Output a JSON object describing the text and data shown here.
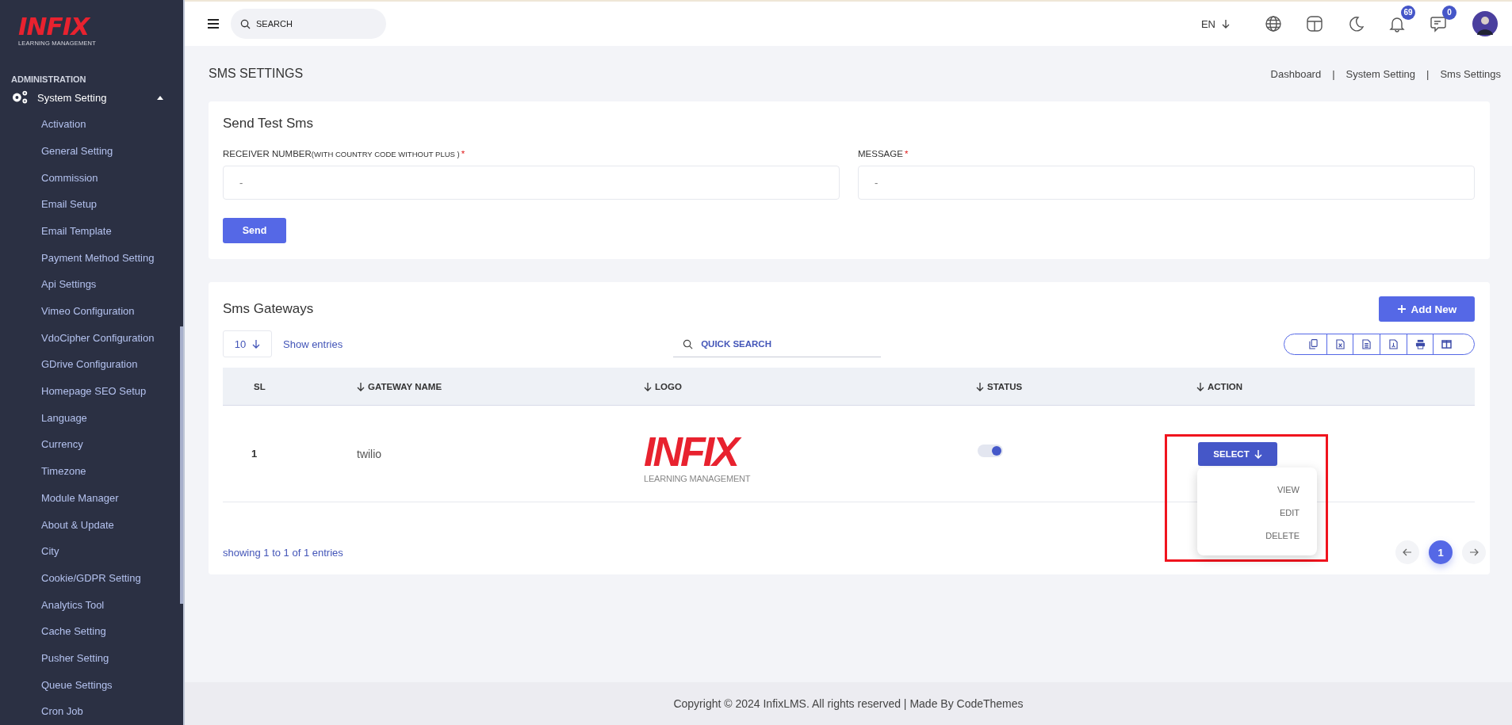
{
  "sidebar": {
    "logo": {
      "wordmark": "INFIX",
      "tagline": "LEARNING MANAGEMENT"
    },
    "section": "ADMINISTRATION",
    "group": {
      "label": "System Setting",
      "expanded": true,
      "items": [
        {
          "label": "Activation"
        },
        {
          "label": "General Setting"
        },
        {
          "label": "Commission"
        },
        {
          "label": "Email Setup"
        },
        {
          "label": "Email Template"
        },
        {
          "label": "Payment Method Setting"
        },
        {
          "label": "Api Settings"
        },
        {
          "label": "Vimeo Configuration"
        },
        {
          "label": "VdoCipher Configuration"
        },
        {
          "label": "GDrive Configuration"
        },
        {
          "label": "Homepage SEO Setup"
        },
        {
          "label": "Language"
        },
        {
          "label": "Currency"
        },
        {
          "label": "Timezone"
        },
        {
          "label": "Module Manager"
        },
        {
          "label": "About & Update"
        },
        {
          "label": "City"
        },
        {
          "label": "Cookie/GDPR Setting"
        },
        {
          "label": "Analytics Tool"
        },
        {
          "label": "Cache Setting"
        },
        {
          "label": "Pusher Setting"
        },
        {
          "label": "Queue Settings"
        },
        {
          "label": "Cron Job"
        }
      ]
    }
  },
  "header": {
    "search": {
      "placeholder": "SEARCH"
    },
    "language": "EN",
    "notifications": {
      "badge": "69"
    },
    "messages": {
      "badge": "0"
    }
  },
  "page": {
    "title": "SMS SETTINGS",
    "breadcrumbs": [
      {
        "label": "Dashboard"
      },
      {
        "separator": "|",
        "label": "System Setting"
      },
      {
        "separator": "|",
        "label": "Sms Settings"
      }
    ]
  },
  "test_form": {
    "title": "Send Test Sms",
    "fields": [
      {
        "label": "RECEIVER NUMBER",
        "note": "(WITH COUNTRY CODE WITHOUT PLUS )",
        "required_mark": "*",
        "placeholder": "-"
      },
      {
        "label": "MESSAGE",
        "required_mark": "*",
        "placeholder": "-"
      }
    ],
    "button": "Send"
  },
  "gateways": {
    "title": "Sms Gateways",
    "add_button": "Add New",
    "page_size": "10",
    "show_entries": "Show entries",
    "search": {
      "placeholder": "QUICK SEARCH"
    },
    "columns": [
      {
        "label": "SL",
        "sortable": false
      },
      {
        "label": "GATEWAY NAME",
        "sortable": true
      },
      {
        "label": "LOGO",
        "sortable": true
      },
      {
        "label": "STATUS",
        "sortable": true
      },
      {
        "label": "ACTION",
        "sortable": true
      }
    ],
    "rows": [
      {
        "sl": "1",
        "name": "twilio",
        "logo": {
          "wordmark": "INFIX",
          "tagline": "LEARNING MANAGEMENT"
        },
        "on": true,
        "action": "SELECT",
        "menu_open": true,
        "menu": [
          "VIEW",
          "EDIT",
          "DELETE"
        ]
      }
    ],
    "summary": "showing 1 to 1 of 1 entries",
    "pages": [
      {
        "label": "1",
        "selected": true
      }
    ]
  },
  "footer": "Copyright © 2024 InfixLMS. All rights reserved | Made By CodeThemes"
}
